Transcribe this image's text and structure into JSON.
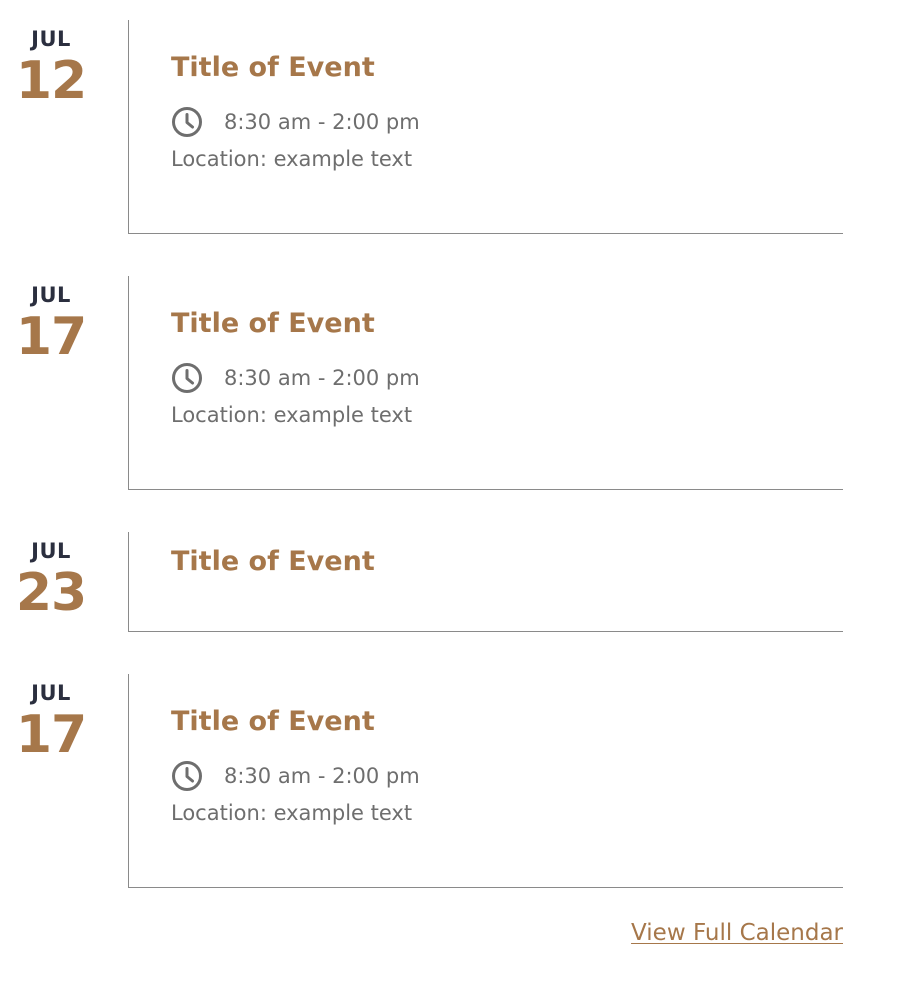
{
  "events": [
    {
      "month": "JUL",
      "day": "12",
      "title": "Title of Event",
      "time": "8:30 am - 2:00 pm",
      "location": "Location: example text",
      "time_icon": "clock-icon"
    },
    {
      "month": "JUL",
      "day": "17",
      "title": "Title of Event",
      "time": "8:30 am - 2:00 pm",
      "location": "Location: example text",
      "time_icon": "clock-icon"
    },
    {
      "month": "JUL",
      "day": "23",
      "title": "Title of Event"
    },
    {
      "month": "JUL",
      "day": "17",
      "title": "Title of Event",
      "time": "8:30 am - 2:00 pm",
      "location": "Location: example text",
      "time_icon": "clock-icon"
    }
  ],
  "footer": {
    "view_calendar_label": "View Full Calendar"
  },
  "colors": {
    "accent": "#a6774a",
    "month_text": "#2b2f3f",
    "body_text": "#6e6e6e",
    "rule": "#8a8a8a"
  }
}
